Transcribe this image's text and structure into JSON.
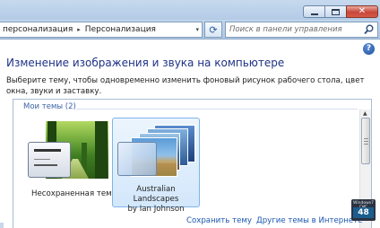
{
  "window": {
    "min_icon": "minimize-icon",
    "max_icon": "maximize-icon",
    "close_icon": "close-icon",
    "close_glyph": "✕"
  },
  "address": {
    "crumbs": [
      "персонализация",
      "Персонализация"
    ],
    "separator": "▸",
    "chevron": "▾",
    "refresh_glyph": "⟳"
  },
  "search": {
    "placeholder": "Поиск в панели управления"
  },
  "help_glyph": "?",
  "heading": "Изменение изображения и звука на компьютере",
  "description": "Выберите тему, чтобы одновременно изменить фоновый рисунок рабочего стола, цвет окна, звуки и заставку.",
  "themes_section": {
    "title": "Мои темы (2)",
    "items": [
      {
        "label": "Несохраненная тема",
        "selected": false
      },
      {
        "label_line1": "Australian Landscapes",
        "label_line2": "by Ian Johnson",
        "selected": true
      }
    ]
  },
  "links": {
    "save": "Сохранить тему",
    "online": "Другие темы в Интернете"
  },
  "watermark": {
    "top": "Windows7 ГИГ",
    "number": "48"
  },
  "colors": {
    "heading": "#1e3287",
    "link": "#1b57b0",
    "selection": "#d3e7fb"
  }
}
